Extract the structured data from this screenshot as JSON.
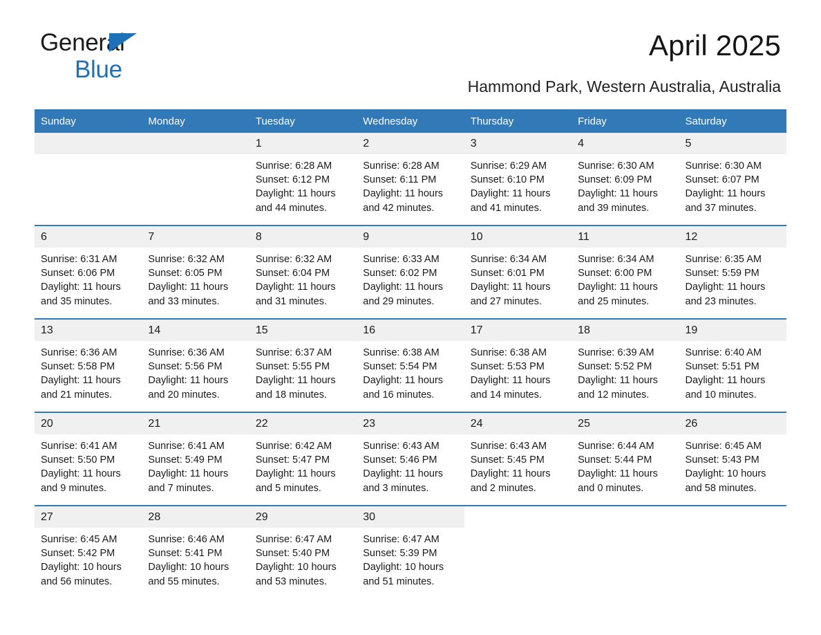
{
  "brand": {
    "name_part1": "General",
    "name_part2": "Blue",
    "accent_color": "#1d71b8"
  },
  "header": {
    "month_title": "April 2025",
    "location": "Hammond Park, Western Australia, Australia"
  },
  "theme": {
    "header_blue": "#3279b7",
    "daynum_gray": "#f0f0f0"
  },
  "weekday_headers": [
    "Sunday",
    "Monday",
    "Tuesday",
    "Wednesday",
    "Thursday",
    "Friday",
    "Saturday"
  ],
  "weeks": [
    [
      {
        "day": "",
        "sunrise": "",
        "sunset": "",
        "daylight": "",
        "empty": true,
        "leading": true
      },
      {
        "day": "",
        "sunrise": "",
        "sunset": "",
        "daylight": "",
        "empty": true,
        "leading": true
      },
      {
        "day": "1",
        "sunrise": "Sunrise: 6:28 AM",
        "sunset": "Sunset: 6:12 PM",
        "daylight": "Daylight: 11 hours and 44 minutes."
      },
      {
        "day": "2",
        "sunrise": "Sunrise: 6:28 AM",
        "sunset": "Sunset: 6:11 PM",
        "daylight": "Daylight: 11 hours and 42 minutes."
      },
      {
        "day": "3",
        "sunrise": "Sunrise: 6:29 AM",
        "sunset": "Sunset: 6:10 PM",
        "daylight": "Daylight: 11 hours and 41 minutes."
      },
      {
        "day": "4",
        "sunrise": "Sunrise: 6:30 AM",
        "sunset": "Sunset: 6:09 PM",
        "daylight": "Daylight: 11 hours and 39 minutes."
      },
      {
        "day": "5",
        "sunrise": "Sunrise: 6:30 AM",
        "sunset": "Sunset: 6:07 PM",
        "daylight": "Daylight: 11 hours and 37 minutes."
      }
    ],
    [
      {
        "day": "6",
        "sunrise": "Sunrise: 6:31 AM",
        "sunset": "Sunset: 6:06 PM",
        "daylight": "Daylight: 11 hours and 35 minutes."
      },
      {
        "day": "7",
        "sunrise": "Sunrise: 6:32 AM",
        "sunset": "Sunset: 6:05 PM",
        "daylight": "Daylight: 11 hours and 33 minutes."
      },
      {
        "day": "8",
        "sunrise": "Sunrise: 6:32 AM",
        "sunset": "Sunset: 6:04 PM",
        "daylight": "Daylight: 11 hours and 31 minutes."
      },
      {
        "day": "9",
        "sunrise": "Sunrise: 6:33 AM",
        "sunset": "Sunset: 6:02 PM",
        "daylight": "Daylight: 11 hours and 29 minutes."
      },
      {
        "day": "10",
        "sunrise": "Sunrise: 6:34 AM",
        "sunset": "Sunset: 6:01 PM",
        "daylight": "Daylight: 11 hours and 27 minutes."
      },
      {
        "day": "11",
        "sunrise": "Sunrise: 6:34 AM",
        "sunset": "Sunset: 6:00 PM",
        "daylight": "Daylight: 11 hours and 25 minutes."
      },
      {
        "day": "12",
        "sunrise": "Sunrise: 6:35 AM",
        "sunset": "Sunset: 5:59 PM",
        "daylight": "Daylight: 11 hours and 23 minutes."
      }
    ],
    [
      {
        "day": "13",
        "sunrise": "Sunrise: 6:36 AM",
        "sunset": "Sunset: 5:58 PM",
        "daylight": "Daylight: 11 hours and 21 minutes."
      },
      {
        "day": "14",
        "sunrise": "Sunrise: 6:36 AM",
        "sunset": "Sunset: 5:56 PM",
        "daylight": "Daylight: 11 hours and 20 minutes."
      },
      {
        "day": "15",
        "sunrise": "Sunrise: 6:37 AM",
        "sunset": "Sunset: 5:55 PM",
        "daylight": "Daylight: 11 hours and 18 minutes."
      },
      {
        "day": "16",
        "sunrise": "Sunrise: 6:38 AM",
        "sunset": "Sunset: 5:54 PM",
        "daylight": "Daylight: 11 hours and 16 minutes."
      },
      {
        "day": "17",
        "sunrise": "Sunrise: 6:38 AM",
        "sunset": "Sunset: 5:53 PM",
        "daylight": "Daylight: 11 hours and 14 minutes."
      },
      {
        "day": "18",
        "sunrise": "Sunrise: 6:39 AM",
        "sunset": "Sunset: 5:52 PM",
        "daylight": "Daylight: 11 hours and 12 minutes."
      },
      {
        "day": "19",
        "sunrise": "Sunrise: 6:40 AM",
        "sunset": "Sunset: 5:51 PM",
        "daylight": "Daylight: 11 hours and 10 minutes."
      }
    ],
    [
      {
        "day": "20",
        "sunrise": "Sunrise: 6:41 AM",
        "sunset": "Sunset: 5:50 PM",
        "daylight": "Daylight: 11 hours and 9 minutes."
      },
      {
        "day": "21",
        "sunrise": "Sunrise: 6:41 AM",
        "sunset": "Sunset: 5:49 PM",
        "daylight": "Daylight: 11 hours and 7 minutes."
      },
      {
        "day": "22",
        "sunrise": "Sunrise: 6:42 AM",
        "sunset": "Sunset: 5:47 PM",
        "daylight": "Daylight: 11 hours and 5 minutes."
      },
      {
        "day": "23",
        "sunrise": "Sunrise: 6:43 AM",
        "sunset": "Sunset: 5:46 PM",
        "daylight": "Daylight: 11 hours and 3 minutes."
      },
      {
        "day": "24",
        "sunrise": "Sunrise: 6:43 AM",
        "sunset": "Sunset: 5:45 PM",
        "daylight": "Daylight: 11 hours and 2 minutes."
      },
      {
        "day": "25",
        "sunrise": "Sunrise: 6:44 AM",
        "sunset": "Sunset: 5:44 PM",
        "daylight": "Daylight: 11 hours and 0 minutes."
      },
      {
        "day": "26",
        "sunrise": "Sunrise: 6:45 AM",
        "sunset": "Sunset: 5:43 PM",
        "daylight": "Daylight: 10 hours and 58 minutes."
      }
    ],
    [
      {
        "day": "27",
        "sunrise": "Sunrise: 6:45 AM",
        "sunset": "Sunset: 5:42 PM",
        "daylight": "Daylight: 10 hours and 56 minutes."
      },
      {
        "day": "28",
        "sunrise": "Sunrise: 6:46 AM",
        "sunset": "Sunset: 5:41 PM",
        "daylight": "Daylight: 10 hours and 55 minutes."
      },
      {
        "day": "29",
        "sunrise": "Sunrise: 6:47 AM",
        "sunset": "Sunset: 5:40 PM",
        "daylight": "Daylight: 10 hours and 53 minutes."
      },
      {
        "day": "30",
        "sunrise": "Sunrise: 6:47 AM",
        "sunset": "Sunset: 5:39 PM",
        "daylight": "Daylight: 10 hours and 51 minutes."
      },
      {
        "day": "",
        "sunrise": "",
        "sunset": "",
        "daylight": "",
        "empty": true,
        "trailing": true
      },
      {
        "day": "",
        "sunrise": "",
        "sunset": "",
        "daylight": "",
        "empty": true,
        "trailing": true
      },
      {
        "day": "",
        "sunrise": "",
        "sunset": "",
        "daylight": "",
        "empty": true,
        "trailing": true
      }
    ]
  ]
}
